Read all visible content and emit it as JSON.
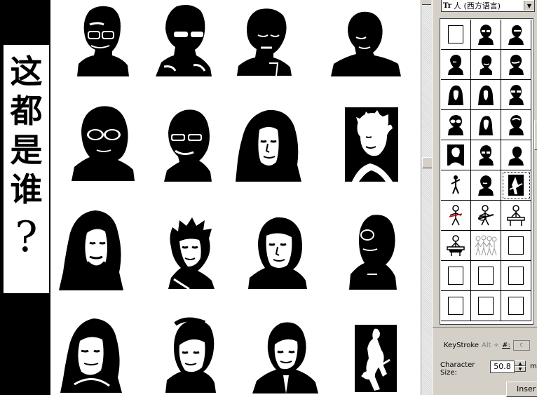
{
  "banner": {
    "chars": [
      "这",
      "都",
      "是",
      "谁"
    ],
    "question": "?"
  },
  "portraits": [
    {
      "name": "portrait-1-1"
    },
    {
      "name": "portrait-1-2"
    },
    {
      "name": "portrait-1-3"
    },
    {
      "name": "portrait-1-4"
    },
    {
      "name": "portrait-2-1"
    },
    {
      "name": "portrait-2-2"
    },
    {
      "name": "portrait-2-3"
    },
    {
      "name": "portrait-2-4"
    },
    {
      "name": "portrait-3-1"
    },
    {
      "name": "portrait-3-2"
    },
    {
      "name": "portrait-3-3"
    },
    {
      "name": "portrait-3-4"
    },
    {
      "name": "portrait-4-1"
    },
    {
      "name": "portrait-4-2"
    },
    {
      "name": "portrait-4-3"
    },
    {
      "name": "portrait-4-4"
    }
  ],
  "symbols_panel": {
    "font_icon": "Tr",
    "font_name": "人 (西方语言)",
    "keystroke_label": "KeyStroke",
    "keystroke_alt": "Alt +",
    "keystroke_hash": "#:",
    "keystroke_value": "c",
    "char_size_label": "Character Size:",
    "char_size_value": "50.8",
    "unit": "m",
    "insert_label": "Inser"
  }
}
